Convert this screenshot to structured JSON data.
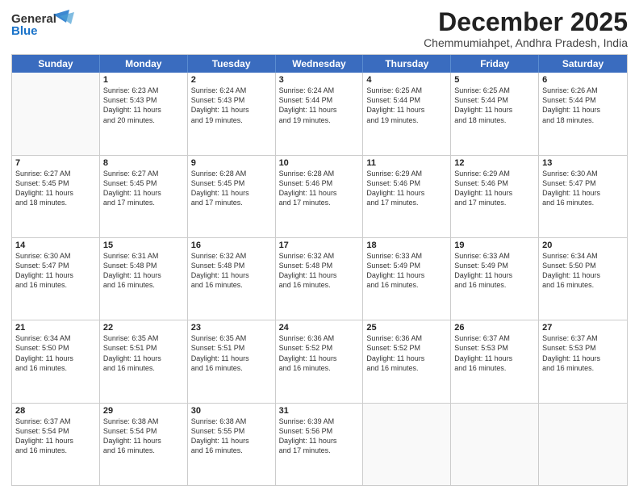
{
  "logo": {
    "general": "General",
    "blue": "Blue"
  },
  "header": {
    "month": "December 2025",
    "location": "Chemmumiahpet, Andhra Pradesh, India"
  },
  "weekdays": [
    "Sunday",
    "Monday",
    "Tuesday",
    "Wednesday",
    "Thursday",
    "Friday",
    "Saturday"
  ],
  "rows": [
    [
      {
        "day": "",
        "info": ""
      },
      {
        "day": "1",
        "info": "Sunrise: 6:23 AM\nSunset: 5:43 PM\nDaylight: 11 hours\nand 20 minutes."
      },
      {
        "day": "2",
        "info": "Sunrise: 6:24 AM\nSunset: 5:43 PM\nDaylight: 11 hours\nand 19 minutes."
      },
      {
        "day": "3",
        "info": "Sunrise: 6:24 AM\nSunset: 5:44 PM\nDaylight: 11 hours\nand 19 minutes."
      },
      {
        "day": "4",
        "info": "Sunrise: 6:25 AM\nSunset: 5:44 PM\nDaylight: 11 hours\nand 19 minutes."
      },
      {
        "day": "5",
        "info": "Sunrise: 6:25 AM\nSunset: 5:44 PM\nDaylight: 11 hours\nand 18 minutes."
      },
      {
        "day": "6",
        "info": "Sunrise: 6:26 AM\nSunset: 5:44 PM\nDaylight: 11 hours\nand 18 minutes."
      }
    ],
    [
      {
        "day": "7",
        "info": "Sunrise: 6:27 AM\nSunset: 5:45 PM\nDaylight: 11 hours\nand 18 minutes."
      },
      {
        "day": "8",
        "info": "Sunrise: 6:27 AM\nSunset: 5:45 PM\nDaylight: 11 hours\nand 17 minutes."
      },
      {
        "day": "9",
        "info": "Sunrise: 6:28 AM\nSunset: 5:45 PM\nDaylight: 11 hours\nand 17 minutes."
      },
      {
        "day": "10",
        "info": "Sunrise: 6:28 AM\nSunset: 5:46 PM\nDaylight: 11 hours\nand 17 minutes."
      },
      {
        "day": "11",
        "info": "Sunrise: 6:29 AM\nSunset: 5:46 PM\nDaylight: 11 hours\nand 17 minutes."
      },
      {
        "day": "12",
        "info": "Sunrise: 6:29 AM\nSunset: 5:46 PM\nDaylight: 11 hours\nand 17 minutes."
      },
      {
        "day": "13",
        "info": "Sunrise: 6:30 AM\nSunset: 5:47 PM\nDaylight: 11 hours\nand 16 minutes."
      }
    ],
    [
      {
        "day": "14",
        "info": "Sunrise: 6:30 AM\nSunset: 5:47 PM\nDaylight: 11 hours\nand 16 minutes."
      },
      {
        "day": "15",
        "info": "Sunrise: 6:31 AM\nSunset: 5:48 PM\nDaylight: 11 hours\nand 16 minutes."
      },
      {
        "day": "16",
        "info": "Sunrise: 6:32 AM\nSunset: 5:48 PM\nDaylight: 11 hours\nand 16 minutes."
      },
      {
        "day": "17",
        "info": "Sunrise: 6:32 AM\nSunset: 5:48 PM\nDaylight: 11 hours\nand 16 minutes."
      },
      {
        "day": "18",
        "info": "Sunrise: 6:33 AM\nSunset: 5:49 PM\nDaylight: 11 hours\nand 16 minutes."
      },
      {
        "day": "19",
        "info": "Sunrise: 6:33 AM\nSunset: 5:49 PM\nDaylight: 11 hours\nand 16 minutes."
      },
      {
        "day": "20",
        "info": "Sunrise: 6:34 AM\nSunset: 5:50 PM\nDaylight: 11 hours\nand 16 minutes."
      }
    ],
    [
      {
        "day": "21",
        "info": "Sunrise: 6:34 AM\nSunset: 5:50 PM\nDaylight: 11 hours\nand 16 minutes."
      },
      {
        "day": "22",
        "info": "Sunrise: 6:35 AM\nSunset: 5:51 PM\nDaylight: 11 hours\nand 16 minutes."
      },
      {
        "day": "23",
        "info": "Sunrise: 6:35 AM\nSunset: 5:51 PM\nDaylight: 11 hours\nand 16 minutes."
      },
      {
        "day": "24",
        "info": "Sunrise: 6:36 AM\nSunset: 5:52 PM\nDaylight: 11 hours\nand 16 minutes."
      },
      {
        "day": "25",
        "info": "Sunrise: 6:36 AM\nSunset: 5:52 PM\nDaylight: 11 hours\nand 16 minutes."
      },
      {
        "day": "26",
        "info": "Sunrise: 6:37 AM\nSunset: 5:53 PM\nDaylight: 11 hours\nand 16 minutes."
      },
      {
        "day": "27",
        "info": "Sunrise: 6:37 AM\nSunset: 5:53 PM\nDaylight: 11 hours\nand 16 minutes."
      }
    ],
    [
      {
        "day": "28",
        "info": "Sunrise: 6:37 AM\nSunset: 5:54 PM\nDaylight: 11 hours\nand 16 minutes."
      },
      {
        "day": "29",
        "info": "Sunrise: 6:38 AM\nSunset: 5:54 PM\nDaylight: 11 hours\nand 16 minutes."
      },
      {
        "day": "30",
        "info": "Sunrise: 6:38 AM\nSunset: 5:55 PM\nDaylight: 11 hours\nand 16 minutes."
      },
      {
        "day": "31",
        "info": "Sunrise: 6:39 AM\nSunset: 5:56 PM\nDaylight: 11 hours\nand 17 minutes."
      },
      {
        "day": "",
        "info": ""
      },
      {
        "day": "",
        "info": ""
      },
      {
        "day": "",
        "info": ""
      }
    ]
  ]
}
